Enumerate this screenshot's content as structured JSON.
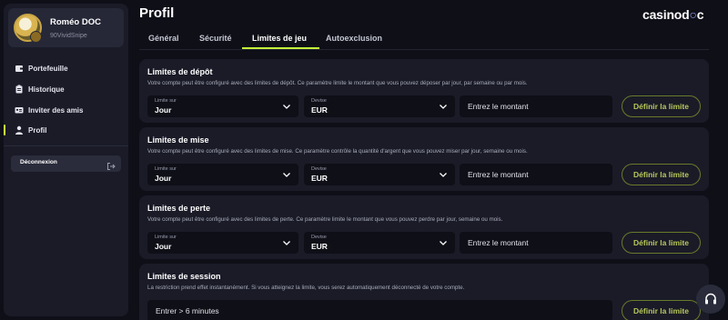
{
  "user": {
    "name": "Roméo DOC",
    "handle": "90VividSnipe"
  },
  "sidebar": {
    "items": [
      {
        "label": "Portefeuille",
        "icon": "wallet-icon"
      },
      {
        "label": "Historique",
        "icon": "clipboard-icon"
      },
      {
        "label": "Inviter des amis",
        "icon": "id-card-icon"
      },
      {
        "label": "Profil",
        "icon": "user-icon",
        "active": true
      }
    ],
    "logout_label": "Déconnexion"
  },
  "header": {
    "title": "Profil",
    "logo_text": "casinod",
    "logo_accent": "c"
  },
  "tabs": [
    {
      "label": "Général"
    },
    {
      "label": "Sécurité"
    },
    {
      "label": "Limites de jeu",
      "active": true
    },
    {
      "label": "Autoexclusion"
    }
  ],
  "limits": [
    {
      "title": "Limites de dépôt",
      "description": "Votre compte peut être configuré avec des limites de dépôt. Ce paramètre limite le montant que vous pouvez déposer par jour, par semaine ou par mois.",
      "period_label": "Limite sur",
      "period_value": "Jour",
      "currency_label": "Devise",
      "currency_value": "EUR",
      "amount_placeholder": "Entrez le montant",
      "button": "Définir la limite"
    },
    {
      "title": "Limites de mise",
      "description": "Votre compte peut être configuré avec des limites de mise. Ce paramètre contrôle la quantité d'argent que vous pouvez miser par jour, semaine ou mois.",
      "period_label": "Limite sur",
      "period_value": "Jour",
      "currency_label": "Devise",
      "currency_value": "EUR",
      "amount_placeholder": "Entrez le montant",
      "button": "Définir la limite"
    },
    {
      "title": "Limites de perte",
      "description": "Votre compte peut être configuré avec des limites de perte. Ce paramètre limite le montant que vous pouvez perdre par jour, semaine ou mois.",
      "period_label": "Limite sur",
      "period_value": "Jour",
      "currency_label": "Devise",
      "currency_value": "EUR",
      "amount_placeholder": "Entrez le montant",
      "button": "Définir la limite"
    },
    {
      "title": "Limites de session",
      "description": "La restriction prend effet instantanément. Si vous atteignez la limite, vous serez automatiquement déconnecté de votre compte.",
      "session_placeholder": "Entrer > 6 minutes",
      "button": "Définir la limite"
    }
  ],
  "colors": {
    "accent": "#c6ff3b",
    "background": "#0e0f17",
    "panel": "#1a1b27",
    "button_text": "#b8c85a"
  },
  "support": {
    "icon": "headset-icon"
  }
}
